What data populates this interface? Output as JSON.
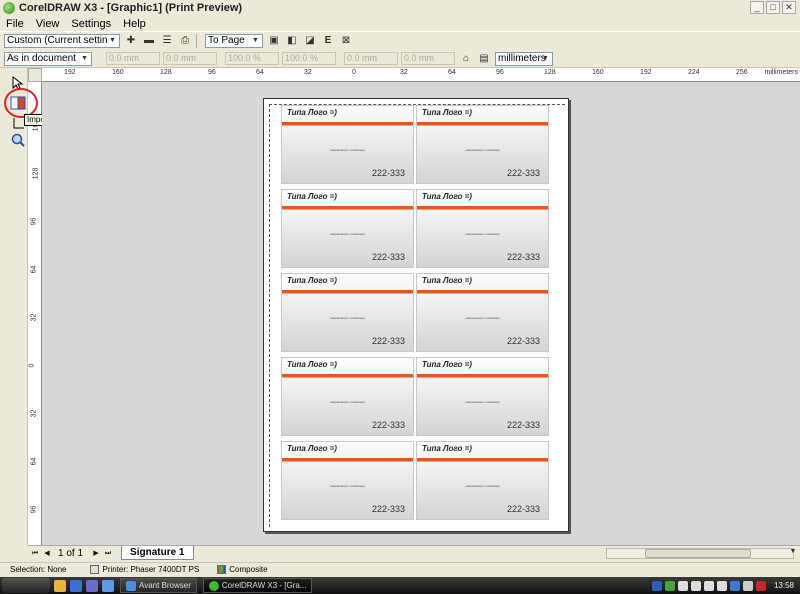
{
  "window": {
    "title": "CorelDRAW X3 - [Graphic1] (Print Preview)"
  },
  "menu": [
    "File",
    "View",
    "Settings",
    "Help"
  ],
  "toolbar": {
    "preset": "Custom (Current settings not s...",
    "fit_mode": "To Page",
    "position": "As in document",
    "units": "millimeters",
    "disabled_fields": [
      "0.0 mm",
      "0.0 mm",
      "100.0 %",
      "100.0 %",
      "0.0 mm",
      "0.0 mm"
    ]
  },
  "ruler": {
    "unit": "millimeters",
    "top_ticks": [
      "192",
      "160",
      "128",
      "96",
      "64",
      "32",
      "0",
      "32",
      "64",
      "96",
      "128",
      "160",
      "192",
      "224",
      "256"
    ],
    "left_ticks": [
      "160",
      "128",
      "96",
      "64",
      "32",
      "0",
      "32",
      "64",
      "96"
    ]
  },
  "tools": {
    "tooltip": "Imposition Layout Tool",
    "items": [
      "pick-tool-icon",
      "imposition-layout-tool-icon",
      "marks-placement-tool-icon",
      "zoom-tool-icon"
    ]
  },
  "cards": {
    "title": "Типа Лого =)",
    "subtitle": "информация о компании",
    "phone": "222-333",
    "stripe_color": "#e2571f"
  },
  "pagination": {
    "current": "1 of 1",
    "tab": "Signature 1"
  },
  "status": {
    "selection": "Selection: None",
    "printer": "Printer: Phaser 7400DT PS",
    "mode": "Composite"
  },
  "taskbar": {
    "buttons": [
      "Avant Browser",
      "CorelDRAW X3 - [Gra..."
    ],
    "clock": "13:58"
  }
}
